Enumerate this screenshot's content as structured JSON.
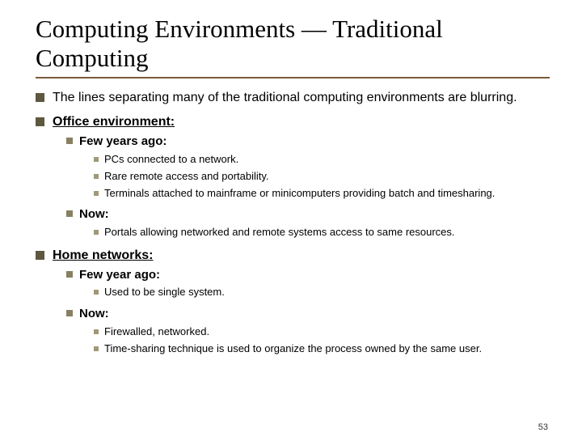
{
  "title": "Computing Environments — Traditional Computing",
  "items": [
    "The lines separating many of the traditional computing environments are blurring.",
    "Office environment:",
    "Home networks:"
  ],
  "office": {
    "few_label": "Few years ago:",
    "few_items": [
      "PCs connected to a network.",
      "Rare remote access and portability.",
      "Terminals attached to mainframe or minicomputers providing batch and timesharing."
    ],
    "now_label": "Now:",
    "now_items": [
      "Portals allowing networked and remote systems access to same resources."
    ]
  },
  "home": {
    "few_label": "Few year ago:",
    "few_items": [
      "Used to be single system."
    ],
    "now_label": "Now:",
    "now_items": [
      "Firewalled, networked.",
      "Time-sharing technique is used to organize the process owned by the same user."
    ]
  },
  "page_number": "53"
}
